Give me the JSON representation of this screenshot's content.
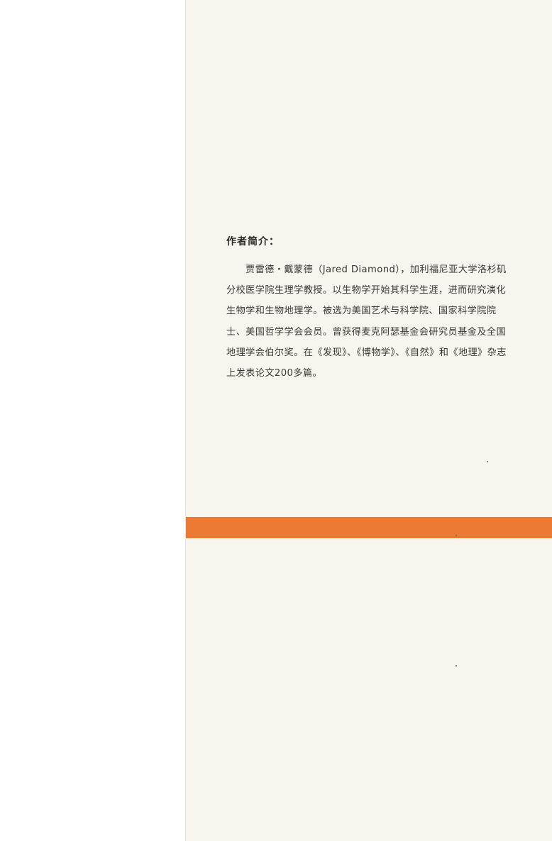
{
  "author_intro": {
    "heading": "作者简介：",
    "body": "贾雷德・戴蒙德（Jared Diamond），加利福尼亚大学洛杉矶分校医学院生理学教授。以生物学开始其科学生涯，进而研究演化生物学和生物地理学。被选为美国艺术与科学院、国家科学院院士、美国哲学学会会员。曾获得麦克阿瑟基金会研究员基金及全国地理学会伯尔奖。在《发现》、《博物学》、《自然》和《地理》杂志上发表论文200多篇。"
  },
  "colors": {
    "flap_background": "#f8f5ee",
    "accent_band": "#ec7a34"
  }
}
